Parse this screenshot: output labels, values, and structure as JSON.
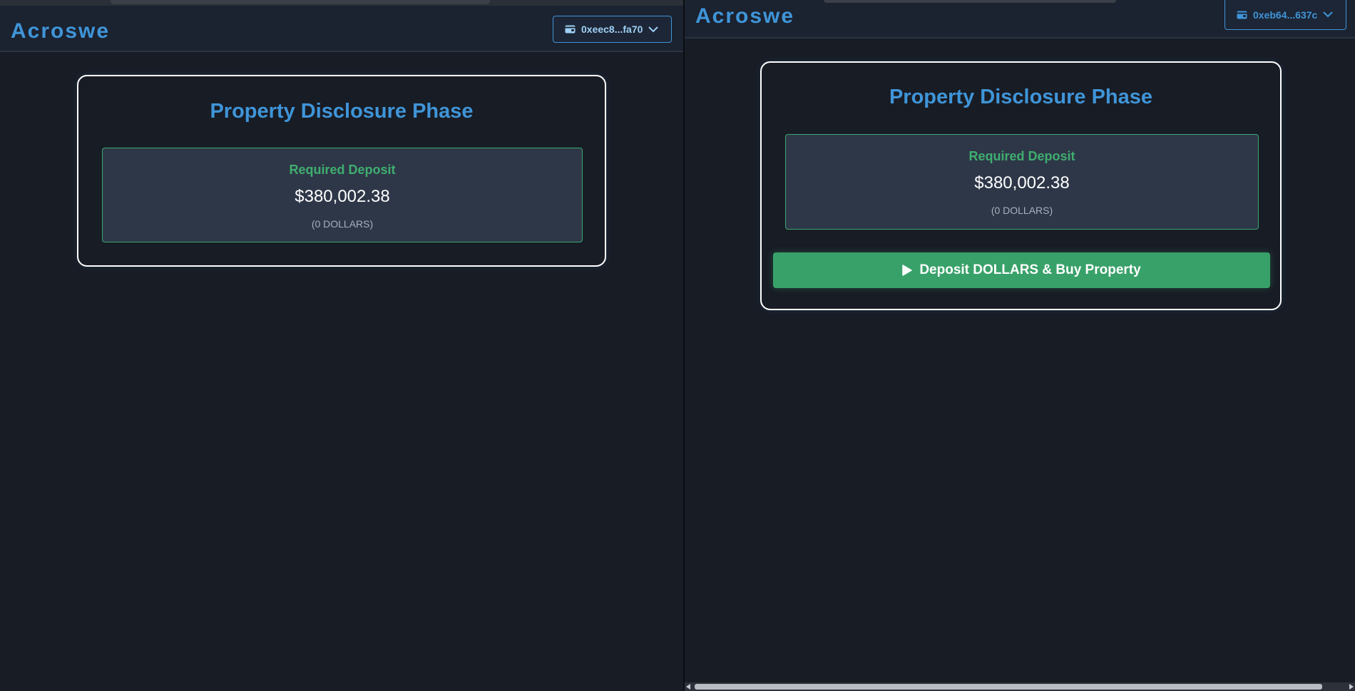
{
  "colors": {
    "background": "#181c25",
    "accent_blue": "#3f95d8",
    "accent_green": "#38a169",
    "card_border": "#ffffff"
  },
  "left_window": {
    "brand": "Acroswe",
    "wallet": {
      "address": "0xeec8...fa70",
      "icon": "wallet-icon",
      "chevron": "chevron-down-icon"
    },
    "card": {
      "title": "Property Disclosure Phase",
      "deposit": {
        "label": "Required Deposit",
        "amount": "$380,002.38",
        "sub": "(0 DOLLARS)"
      }
    }
  },
  "right_window": {
    "brand": "Acroswe",
    "wallet": {
      "address": "0xeb64...637c",
      "icon": "wallet-icon",
      "chevron": "chevron-down-icon"
    },
    "card": {
      "title": "Property Disclosure Phase",
      "deposit": {
        "label": "Required Deposit",
        "amount": "$380,002.38",
        "sub": "(0 DOLLARS)"
      },
      "action_button": {
        "label": "Deposit DOLLARS & Buy Property",
        "icon": "play-icon"
      }
    }
  }
}
